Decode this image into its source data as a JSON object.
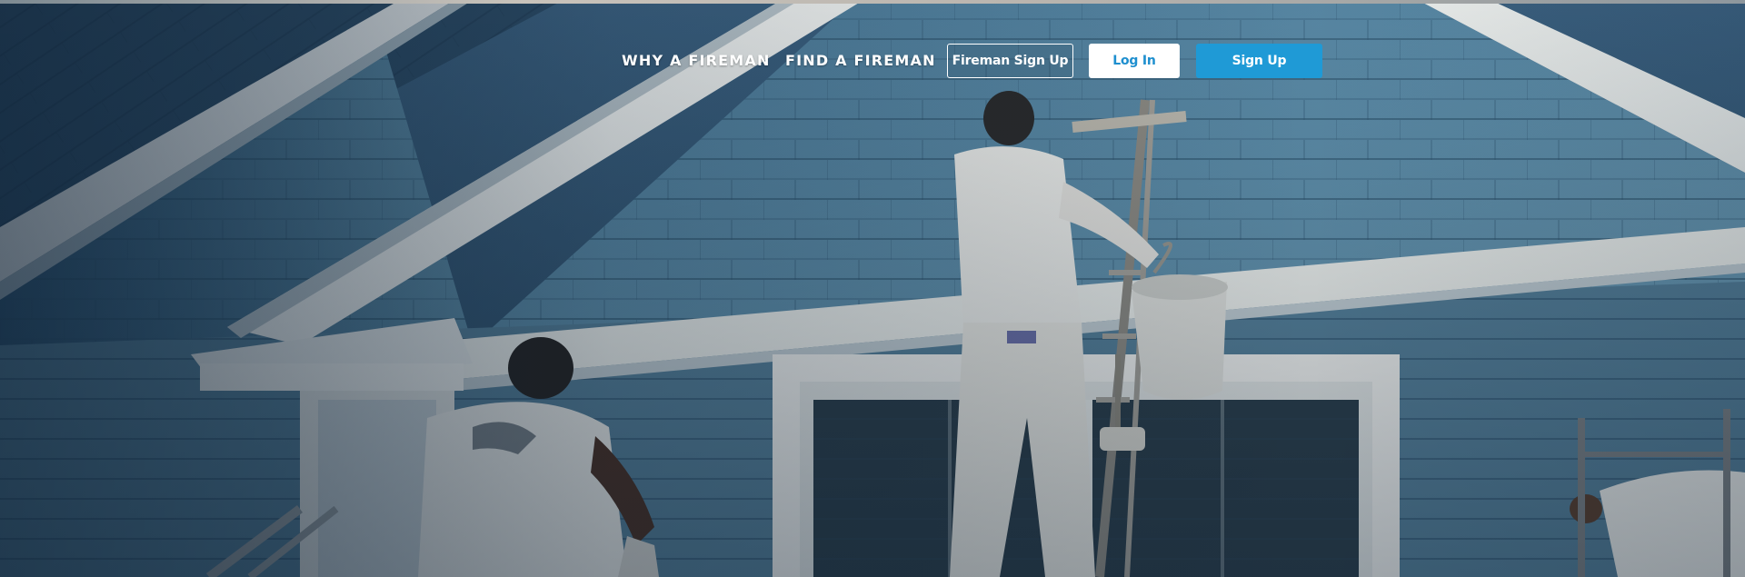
{
  "nav": {
    "why_label": "WHY A FIREMAN",
    "find_label": "FIND A FIREMAN"
  },
  "buttons": {
    "fireman_signup_label": "Fireman Sign Up",
    "login_label": "Log In",
    "signup_label": "Sign Up"
  },
  "colors": {
    "accent": "#1f9ad6",
    "login_text": "#1e8fcf",
    "siding": "#4f7e98",
    "trim": "#f2f2ee"
  }
}
